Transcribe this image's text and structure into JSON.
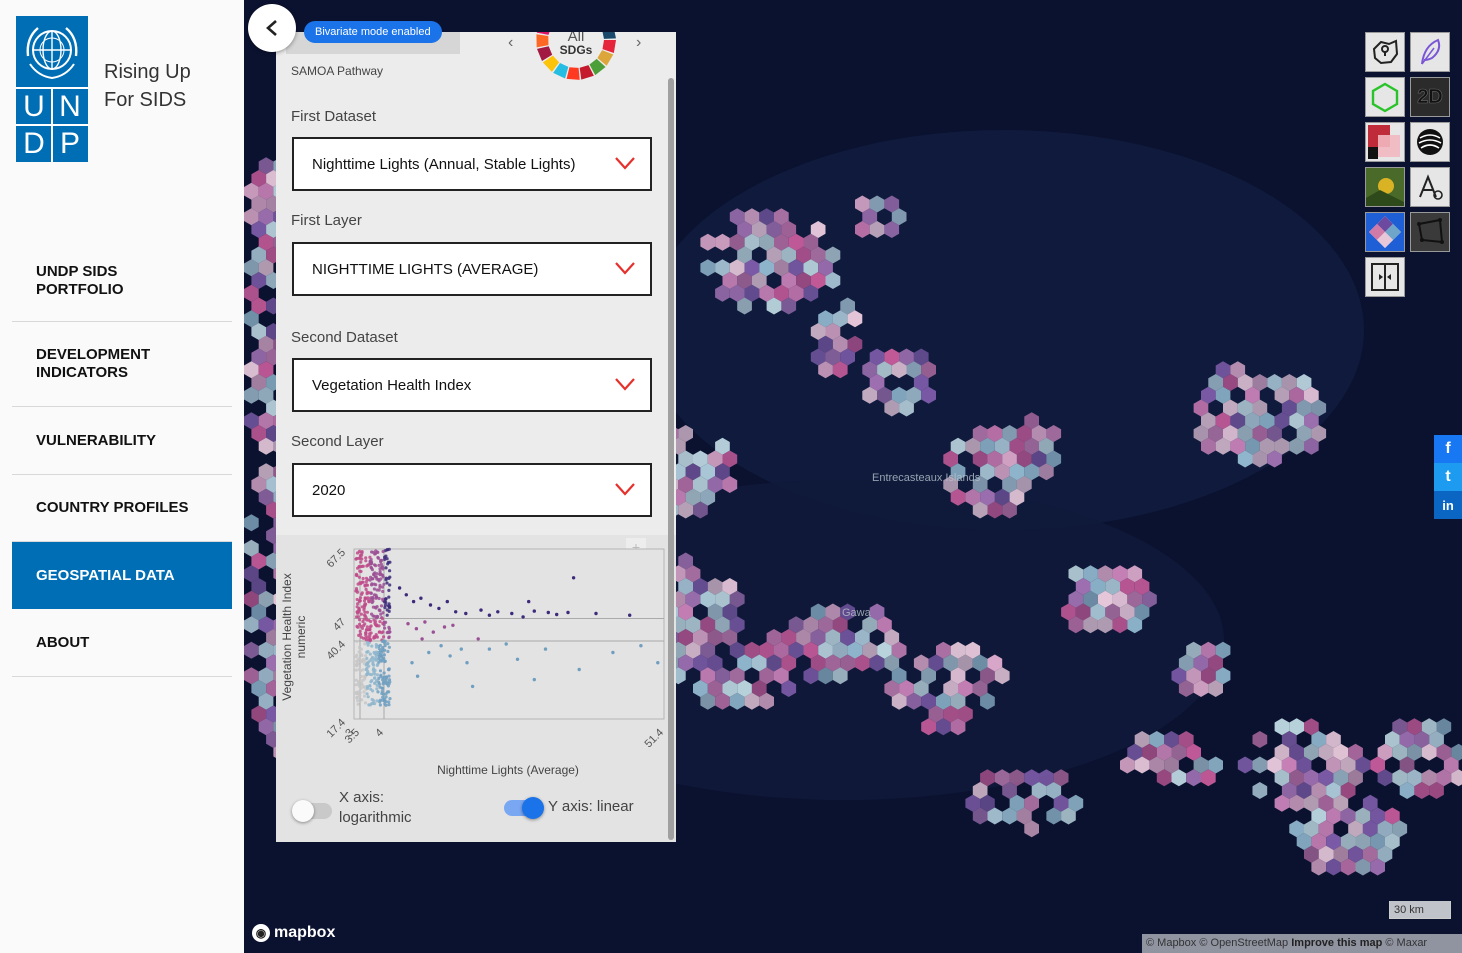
{
  "brand": {
    "line1": "Rising Up",
    "line2": "For SIDS",
    "logo_letters": [
      "U",
      "N",
      "D",
      "P"
    ]
  },
  "nav": {
    "items": [
      {
        "label_line1": "UNDP SIDS",
        "label_line2": "PORTFOLIO",
        "active": false
      },
      {
        "label_line1": "DEVELOPMENT",
        "label_line2": "INDICATORS",
        "active": false
      },
      {
        "label_line1": "VULNERABILITY",
        "label_line2": "",
        "active": false
      },
      {
        "label_line1": "COUNTRY PROFILES",
        "label_line2": "",
        "active": false
      },
      {
        "label_line1": "GEOSPATIAL DATA",
        "label_line2": "",
        "active": true
      },
      {
        "label_line1": "ABOUT",
        "label_line2": "",
        "active": false
      }
    ]
  },
  "badge": "Bivariate mode enabled",
  "panel": {
    "pathway": "SAMOA Pathway",
    "sdg": {
      "line1": "All",
      "line2": "SDGs",
      "prev_icon": "chevron-left-icon",
      "next_icon": "chevron-right-icon"
    },
    "first_dataset": {
      "label": "First Dataset",
      "value": "Nighttime Lights (Annual, Stable Lights)"
    },
    "first_layer": {
      "label": "First Layer",
      "value": "NIGHTTIME LIGHTS (AVERAGE)"
    },
    "second_dataset": {
      "label": "Second Dataset",
      "value": "Vegetation Health Index"
    },
    "second_layer": {
      "label": "Second Layer",
      "value": "2020"
    },
    "x_toggle": {
      "label_line1": "X axis:",
      "label_line2": "logarithmic",
      "on": false
    },
    "y_toggle": {
      "label": "Y axis: linear",
      "on": true
    },
    "plus": "+"
  },
  "chart_data": {
    "type": "scatter",
    "xlabel": "Nighttime Lights (Average)",
    "ylabel_line1": "Vegetation Health Index",
    "ylabel_line2": "numeric",
    "x_ticks": [
      "3",
      "3.5",
      "4",
      "51.4"
    ],
    "y_ticks": [
      "17.4",
      "40.4",
      "47",
      "67.5"
    ],
    "xlim": [
      3,
      51.4
    ],
    "ylim": [
      17.4,
      67.5
    ],
    "x_thresholds": [
      3.5,
      4
    ],
    "y_thresholds": [
      40.4,
      47
    ],
    "colors": {
      "high_low": "#3d2a7a",
      "high_mid": "#9b4f94",
      "low_high": "#c04b8a",
      "mid": "#8fb6cc",
      "low": "#c7c7c7",
      "low_mid_blue": "#6f9fc0"
    },
    "points": [
      [
        5.0,
        56
      ],
      [
        6.2,
        54
      ],
      [
        7.5,
        52
      ],
      [
        8.8,
        53
      ],
      [
        10.5,
        51
      ],
      [
        12,
        50
      ],
      [
        13.5,
        52
      ],
      [
        15,
        49
      ],
      [
        16.8,
        48.5
      ],
      [
        19.5,
        49.5
      ],
      [
        21,
        48
      ],
      [
        22.5,
        49
      ],
      [
        25,
        48.5
      ],
      [
        27,
        47.5
      ],
      [
        29,
        49.2
      ],
      [
        31.5,
        48.8
      ],
      [
        33,
        48.2
      ],
      [
        35,
        48.8
      ],
      [
        40,
        48.5
      ],
      [
        46,
        48
      ],
      [
        36,
        59
      ],
      [
        28,
        52
      ],
      [
        6.5,
        45.5
      ],
      [
        8,
        44
      ],
      [
        9.5,
        46
      ],
      [
        11,
        43
      ],
      [
        13,
        44.5
      ],
      [
        14.5,
        45
      ],
      [
        9,
        41
      ],
      [
        10.2,
        37
      ],
      [
        12.4,
        39
      ],
      [
        14,
        36
      ],
      [
        17,
        34
      ],
      [
        19,
        41
      ],
      [
        21,
        38
      ],
      [
        24,
        39.5
      ],
      [
        26,
        35
      ],
      [
        31,
        38
      ],
      [
        37,
        32
      ],
      [
        43,
        37
      ],
      [
        48,
        39
      ],
      [
        51,
        34
      ],
      [
        18,
        27
      ],
      [
        29,
        29
      ],
      [
        16,
        38
      ],
      [
        7.2,
        34
      ],
      [
        8.2,
        30
      ]
    ]
  },
  "map": {
    "labels": [
      "Entrecasteaux Islands",
      "Gawa"
    ],
    "scale": "30 km",
    "attribution": {
      "part1": "© Mapbox © OpenStreetMap",
      "improve": "Improve this map",
      "part2": "© Maxar"
    },
    "mapbox_wordmark": "mapbox"
  },
  "tools": [
    {
      "name": "region-select-icon"
    },
    {
      "name": "feather-icon"
    },
    {
      "name": "hexagon-icon"
    },
    {
      "name": "2d-3d-toggle",
      "text": "2D"
    },
    {
      "name": "bivariate-layers-icon"
    },
    {
      "name": "globe-stripes-icon"
    },
    {
      "name": "satellite-basemap-icon"
    },
    {
      "name": "labels-icon"
    },
    {
      "name": "bivariate-legend-icon"
    },
    {
      "name": "polygon-draw-icon"
    },
    {
      "name": "compare-swipe-icon"
    }
  ],
  "share": [
    {
      "name": "facebook-icon",
      "glyph": "f"
    },
    {
      "name": "twitter-icon",
      "glyph": "t"
    },
    {
      "name": "linkedin-icon",
      "glyph": "in"
    }
  ]
}
